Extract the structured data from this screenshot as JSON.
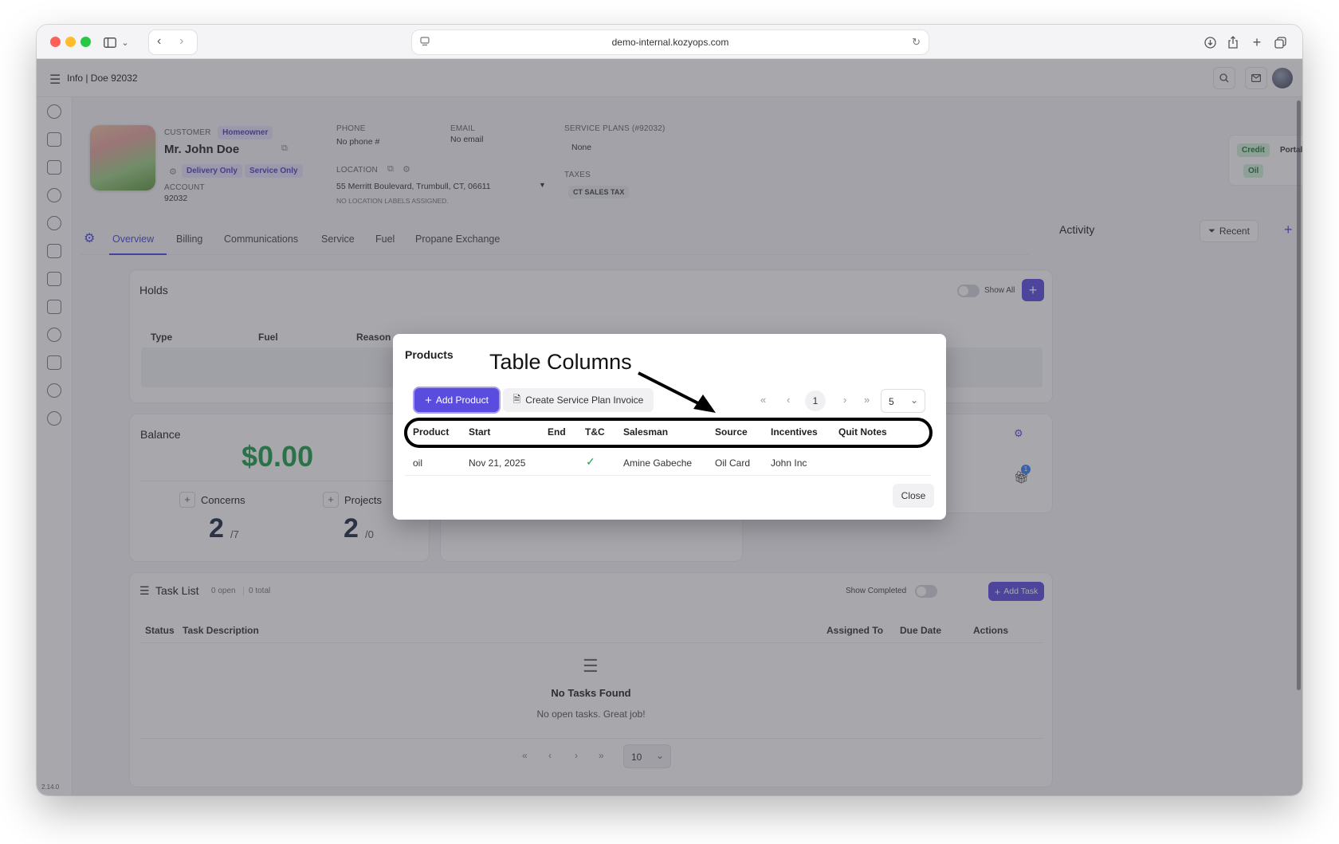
{
  "browser": {
    "url": "demo-internal.kozyops.com"
  },
  "header": {
    "title": "Info | Doe 92032"
  },
  "customer": {
    "customer_label": "CUSTOMER",
    "type_badge": "Homeowner",
    "name": "Mr. John Doe",
    "badges": [
      "Delivery Only",
      "Service Only"
    ],
    "account_label": "ACCOUNT",
    "account": "92032",
    "phone_label": "PHONE",
    "phone": "No phone #",
    "email_label": "EMAIL",
    "email": "No email",
    "location_label": "LOCATION",
    "address": "55 Merritt Boulevard, Trumbull, CT, 06611",
    "location_note": "NO LOCATION LABELS ASSIGNED.",
    "service_plans_label": "SERVICE PLANS (#92032)",
    "service_plans": "None",
    "taxes_label": "TAXES",
    "tax": "CT SALES TAX",
    "flags": [
      "Credit",
      "Portal",
      "Oil"
    ]
  },
  "tabs": [
    "Overview",
    "Billing",
    "Communications",
    "Service",
    "Fuel",
    "Propane Exchange"
  ],
  "activity": {
    "title": "Activity",
    "filter": "Recent"
  },
  "holds": {
    "title": "Holds",
    "show_all": "Show All",
    "columns": [
      "Type",
      "Fuel",
      "Reason"
    ]
  },
  "balance": {
    "title": "Balance",
    "amount": "$0.00",
    "concerns_label": "Concerns",
    "concerns_count": "2",
    "concerns_total": "/7",
    "projects_label": "Projects",
    "projects_count": "2",
    "projects_total": "/0"
  },
  "tasks": {
    "title": "Task List",
    "open": "0 open",
    "total": "0 total",
    "show_completed": "Show Completed",
    "add_task": "Add Task",
    "columns": [
      "Status",
      "Task Description",
      "Assigned To",
      "Due Date",
      "Actions"
    ],
    "empty_title": "No Tasks Found",
    "empty_sub": "No open tasks. Great job!",
    "page_size": "10"
  },
  "modal": {
    "title": "Products",
    "annotation": "Table Columns",
    "add_product": "Add Product",
    "create_invoice": "Create Service Plan Invoice",
    "page": "1",
    "page_size": "5",
    "columns": [
      "Product",
      "Start",
      "End",
      "T&C",
      "Salesman",
      "Source",
      "Incentives",
      "Quit Notes"
    ],
    "row": {
      "product": "oil",
      "start": "Nov 21, 2025",
      "end": "",
      "tc": "✓",
      "salesman": "Amine Gabeche",
      "source": "Oil Card",
      "incentives": "John Inc",
      "quit_notes": ""
    },
    "close": "Close"
  },
  "version": "2.14.0",
  "colors": {
    "accent": "#5b4ce0",
    "balance_green": "#1e9e4a"
  }
}
